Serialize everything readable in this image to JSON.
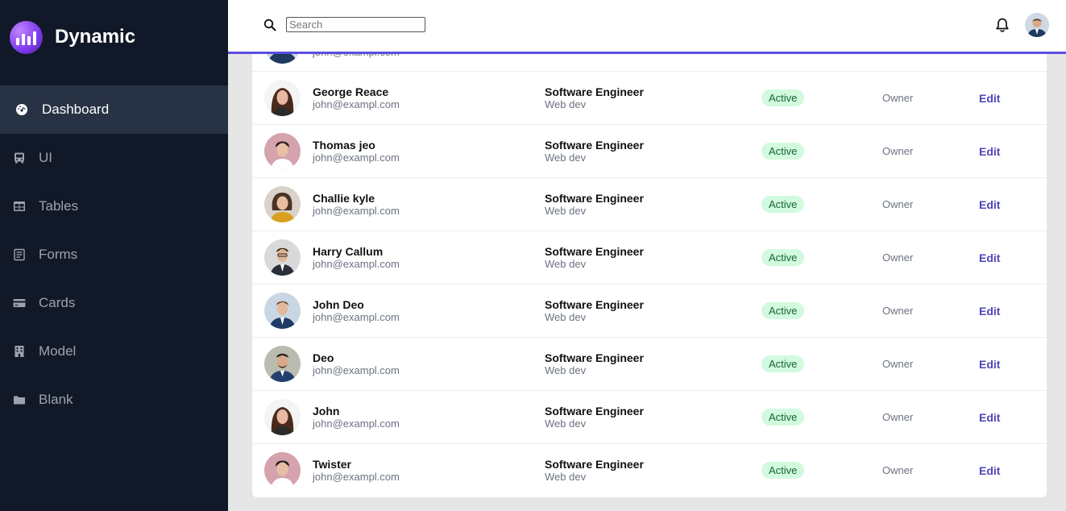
{
  "brand": {
    "name": "Dynamic"
  },
  "sidebar": {
    "items": [
      {
        "label": "Dashboard",
        "icon": "dashboard-icon",
        "active": true
      },
      {
        "label": "UI",
        "icon": "bus-icon"
      },
      {
        "label": "Tables",
        "icon": "table-icon"
      },
      {
        "label": "Forms",
        "icon": "form-icon"
      },
      {
        "label": "Cards",
        "icon": "card-icon"
      },
      {
        "label": "Model",
        "icon": "building-icon"
      },
      {
        "label": "Blank",
        "icon": "folder-icon"
      }
    ]
  },
  "header": {
    "search_placeholder": "Search"
  },
  "table": {
    "rows": [
      {
        "name": "George Reace",
        "email": "john@exampl.com",
        "role": "Software Engineer",
        "dept": "Web dev",
        "status": "Active",
        "access": "Owner",
        "action": "Edit"
      },
      {
        "name": "Thomas jeo",
        "email": "john@exampl.com",
        "role": "Software Engineer",
        "dept": "Web dev",
        "status": "Active",
        "access": "Owner",
        "action": "Edit"
      },
      {
        "name": "Challie kyle",
        "email": "john@exampl.com",
        "role": "Software Engineer",
        "dept": "Web dev",
        "status": "Active",
        "access": "Owner",
        "action": "Edit"
      },
      {
        "name": "Harry Callum",
        "email": "john@exampl.com",
        "role": "Software Engineer",
        "dept": "Web dev",
        "status": "Active",
        "access": "Owner",
        "action": "Edit"
      },
      {
        "name": "John Deo",
        "email": "john@exampl.com",
        "role": "Software Engineer",
        "dept": "Web dev",
        "status": "Active",
        "access": "Owner",
        "action": "Edit"
      },
      {
        "name": "Deo",
        "email": "john@exampl.com",
        "role": "Software Engineer",
        "dept": "Web dev",
        "status": "Active",
        "access": "Owner",
        "action": "Edit"
      },
      {
        "name": "John",
        "email": "john@exampl.com",
        "role": "Software Engineer",
        "dept": "Web dev",
        "status": "Active",
        "access": "Owner",
        "action": "Edit"
      },
      {
        "name": "Twister",
        "email": "john@exampl.com",
        "role": "Software Engineer",
        "dept": "Web dev",
        "status": "Active",
        "access": "Owner",
        "action": "Edit"
      }
    ]
  },
  "colors": {
    "sidebar_bg": "#111827",
    "active_bg": "#273244",
    "accent": "#5b4fe0",
    "badge_bg": "#d1fadf",
    "edit": "#4f46b8"
  }
}
